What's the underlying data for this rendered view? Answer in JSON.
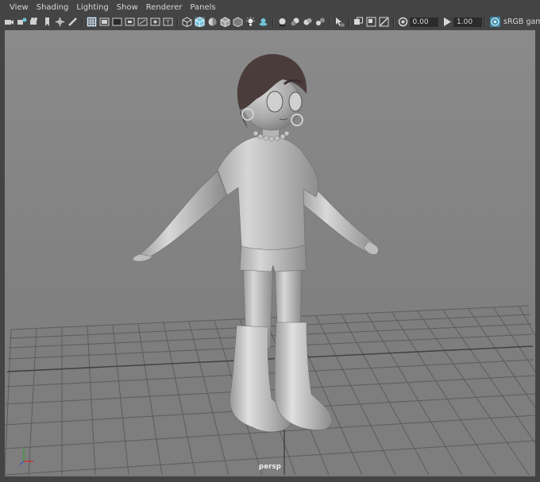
{
  "menu": {
    "items": [
      "View",
      "Shading",
      "Lighting",
      "Show",
      "Renderer",
      "Panels"
    ]
  },
  "toolbar": {
    "icons": [
      "select-camera-icon",
      "camera-attributes-icon",
      "bookmarks-icon",
      "image-plane-icon",
      "2d-pan-zoom-icon",
      "grease-pencil-icon",
      "grid-icon",
      "film-gate-icon",
      "resolution-gate-icon",
      "gate-mask-icon",
      "field-chart-icon",
      "safe-action-icon",
      "safe-title-icon",
      "wireframe-icon",
      "smooth-shade-icon",
      "default-material-icon",
      "wireframe-on-shaded-icon",
      "textured-icon",
      "use-all-lights-icon",
      "shadows-icon",
      "ambient-occlusion-icon",
      "motion-blur-icon",
      "multisample-aa-icon",
      "depth-of-field-icon",
      "isolate-select-icon",
      "xray-icon",
      "xray-joints-icon",
      "xray-components-icon",
      "exposure-icon",
      "gamma-icon",
      "color-management-icon"
    ],
    "exposure_value": "0.00",
    "gamma_value": "1.00",
    "view_transform_label": "sRGB gamm"
  },
  "viewport": {
    "camera_label": "persp",
    "background_color": "#848484",
    "grid_color": "#5a5a5a"
  },
  "colors": {
    "ui_bg": "#444444",
    "active_button": "#5d7385",
    "field_bg": "#2b2b2b"
  }
}
